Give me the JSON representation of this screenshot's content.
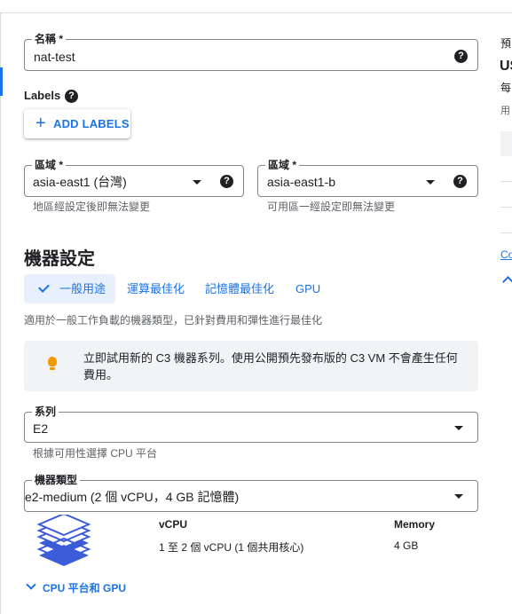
{
  "name_field": {
    "label": "名稱 *",
    "value": "nat-test",
    "help": "?"
  },
  "labels": {
    "title": "Labels",
    "help": "?",
    "add_button": "ADD LABELS",
    "plus": "+"
  },
  "region": {
    "label": "區域 *",
    "value": "asia-east1 (台灣)",
    "hint": "地區經設定後即無法變更",
    "help": "?"
  },
  "zone": {
    "label": "區域 *",
    "value": "asia-east1-b",
    "hint": "可用區一經設定即無法變更",
    "help": "?"
  },
  "machine_config": {
    "title": "機器設定",
    "tabs": [
      {
        "label": "一般用途",
        "active": true
      },
      {
        "label": "運算最佳化",
        "active": false
      },
      {
        "label": "記憶體最佳化",
        "active": false
      },
      {
        "label": "GPU",
        "active": false
      }
    ],
    "tab_description": "適用於一般工作負載的機器類型，已針對費用和彈性進行最佳化",
    "info_text": "立即試用新的 C3 機器系列。使用公開預先發布版的 C3 VM 不會產生任何費用。"
  },
  "series": {
    "label": "系列",
    "value": "E2",
    "hint": "根據可用性選擇 CPU 平台"
  },
  "machine_type": {
    "label": "機器類型",
    "value": "e2-medium (2 個 vCPU，4 GB 記憶體)"
  },
  "specs": {
    "vcpu_header": "vCPU",
    "vcpu_value": "1 至 2 個 vCPU (1 個共用核心)",
    "memory_header": "Memory",
    "memory_value": "4 GB"
  },
  "cpu_toggle": "CPU 平台和 GPU",
  "right_panel": {
    "title": "預",
    "price": "US",
    "line2": "每",
    "line3": "用",
    "link": "Co"
  },
  "colors": {
    "accent": "#1a73e8",
    "tab_bg": "#e8f0fe",
    "info_bg": "#f1f3f4",
    "bulb": "#f29900"
  },
  "icons": [
    "help-icon",
    "plus-icon",
    "caret-down-icon",
    "check-icon",
    "lightbulb-icon",
    "chevron-down-icon",
    "chevron-up-icon",
    "layers-icon"
  ]
}
